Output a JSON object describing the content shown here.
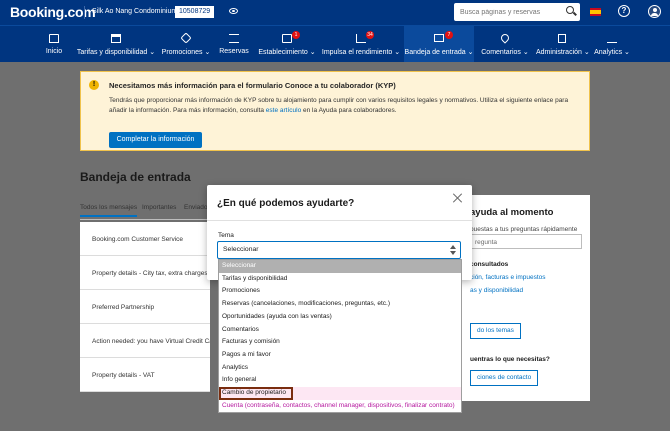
{
  "header": {
    "logo": "Booking.com",
    "property_name": "Silk Ao Nang Condominium",
    "property_id": "10508729",
    "search_placeholder": "Busca páginas y reservas"
  },
  "nav": {
    "items": [
      {
        "label": "Inicio",
        "icon": "home-icon"
      },
      {
        "label": "Tarifas y disponibilidad ⌄",
        "icon": "calendar-icon"
      },
      {
        "label": "Promociones ⌄",
        "icon": "tag-icon"
      },
      {
        "label": "Reservas",
        "icon": "list-icon"
      },
      {
        "label": "Establecimiento ⌄",
        "icon": "building-icon",
        "badge": "1"
      },
      {
        "label": "Impulsa el rendimiento ⌄",
        "icon": "growth-chart-icon",
        "badge": "34"
      },
      {
        "label": "Bandeja de entrada ⌄",
        "icon": "mail-icon",
        "badge": "7",
        "active": true
      },
      {
        "label": "Comentarios ⌄",
        "icon": "heart-icon"
      },
      {
        "label": "Administración ⌄",
        "icon": "document-icon"
      },
      {
        "label": "Analytics ⌄",
        "icon": "bar-chart-icon"
      }
    ]
  },
  "kyp": {
    "title": "Necesitamos más información para el formulario Conoce a tu colaborador (KYP)",
    "text_1": "Tendrás que proporcionar más información de KYP sobre tu alojamiento para cumplir con varios requisitos legales y normativos. Utiliza el siguiente enlace para añadir la información. Para más información, consulta ",
    "link": "este artículo",
    "text_2": " en la Ayuda para colaboradores.",
    "button": "Completar la información"
  },
  "inbox": {
    "title": "Bandeja de entrada",
    "tabs": [
      "Todos los mensajes",
      "Importantes",
      "Enviados"
    ],
    "messages": [
      "Booking.com Customer Service",
      "Property details - City tax, extra charges",
      "Preferred Partnership",
      "Action needed: you have Virtual Credit Cards",
      "Property details - VAT"
    ]
  },
  "help_panel": {
    "title": "ayuda al momento",
    "text": "puestas a tus preguntas rápidamente",
    "search_placeholder": "regunta",
    "subtitle": "consultados",
    "links": [
      "ción, facturas e impuestos",
      "as y disponibilidad"
    ],
    "all_topics_button": "do los temas",
    "question": "uentras lo que necesitas?",
    "contact_button": "ciones de contacto"
  },
  "modal": {
    "title": "¿En qué podemos ayudarte?",
    "field_label": "Tema",
    "selected_value": "Seleccionar",
    "options": [
      "Seleccionar",
      "Tarifas y disponibilidad",
      "Promociones",
      "Reservas (cancelaciones, modificaciones, preguntas, etc.)",
      "Oportunidades (ayuda con las ventas)",
      "Comentarios",
      "Facturas y comisión",
      "Pagos a mi favor",
      "Analytics",
      "Info general",
      "Cambio de propietario",
      "Cuenta (contraseña, contactos, channel manager, dispositivos, finalizar contrato)"
    ]
  },
  "colors": {
    "brand_blue": "#003580",
    "accent_blue": "#0071c2",
    "badge_red": "#e21111",
    "warning_bg": "#fef3d7",
    "highlight_border": "#7a2d0f"
  }
}
